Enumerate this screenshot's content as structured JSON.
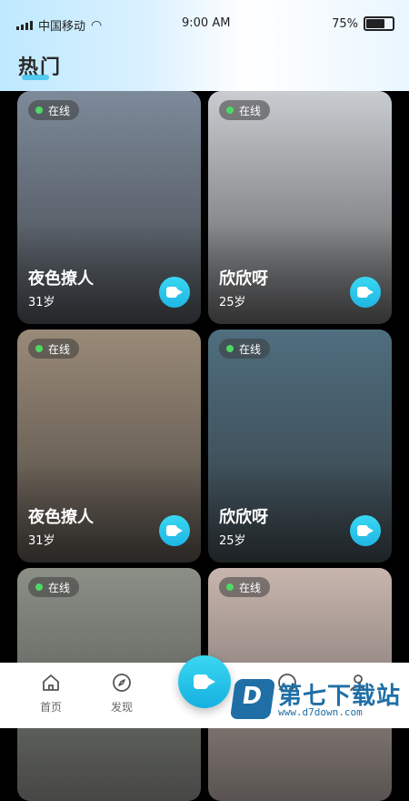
{
  "status_bar": {
    "carrier": "中国移动",
    "time": "9:00 AM",
    "battery": "75%",
    "battery_level": 0.75
  },
  "header": {
    "title": "热门"
  },
  "cards": [
    {
      "online_label": "在线",
      "name": "夜色撩人",
      "age": "31岁",
      "photo_bg": "#7d8a9a"
    },
    {
      "online_label": "在线",
      "name": "欣欣呀",
      "age": "25岁",
      "photo_bg": "#c9ccd0"
    },
    {
      "online_label": "在线",
      "name": "夜色撩人",
      "age": "31岁",
      "photo_bg": "#9a8a78"
    },
    {
      "online_label": "在线",
      "name": "欣欣呀",
      "age": "25岁",
      "photo_bg": "#4f6e7f"
    },
    {
      "online_label": "在线",
      "name": "",
      "age": "",
      "photo_bg": "#8b8f86"
    },
    {
      "online_label": "在线",
      "name": "",
      "age": "",
      "photo_bg": "#c8b6ae"
    }
  ],
  "tabbar": {
    "items": [
      {
        "label": "首页",
        "icon": "home-icon"
      },
      {
        "label": "发现",
        "icon": "compass-icon"
      },
      {
        "label": "",
        "icon": "chat-icon"
      },
      {
        "label": "",
        "icon": "profile-icon"
      }
    ],
    "center_icon": "video-call-icon"
  },
  "watermark": {
    "logo_letter": "D",
    "text": "第七下载站",
    "url": "www.d7down.com"
  },
  "colors": {
    "accent": "#27c3ea",
    "online_dot": "#4cd964",
    "watermark": "#1f6fa6"
  }
}
